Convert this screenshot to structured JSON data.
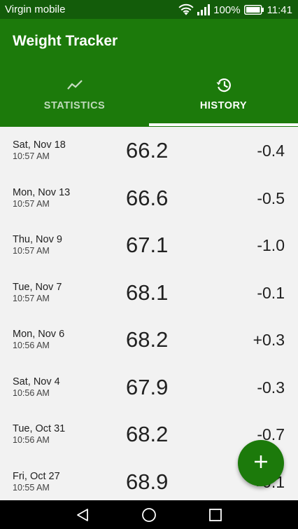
{
  "status_bar": {
    "carrier": "Virgin mobile",
    "battery": "100%",
    "time": "11:41",
    "icons": [
      "wifi-icon",
      "signal-icon",
      "battery-icon"
    ]
  },
  "app": {
    "title": "Weight Tracker"
  },
  "tabs": [
    {
      "label": "STATISTICS",
      "icon": "trending-up-icon",
      "selected": false
    },
    {
      "label": "HISTORY",
      "icon": "history-icon",
      "selected": true
    }
  ],
  "entries": [
    {
      "date": "Sat, Nov 18",
      "time": "10:57 AM",
      "weight": "66.2",
      "change": "-0.4"
    },
    {
      "date": "Mon, Nov 13",
      "time": "10:57 AM",
      "weight": "66.6",
      "change": "-0.5"
    },
    {
      "date": "Thu, Nov 9",
      "time": "10:57 AM",
      "weight": "67.1",
      "change": "-1.0"
    },
    {
      "date": "Tue, Nov 7",
      "time": "10:57 AM",
      "weight": "68.1",
      "change": "-0.1"
    },
    {
      "date": "Mon, Nov 6",
      "time": "10:56 AM",
      "weight": "68.2",
      "change": "+0.3"
    },
    {
      "date": "Sat, Nov 4",
      "time": "10:56 AM",
      "weight": "67.9",
      "change": "-0.3"
    },
    {
      "date": "Tue, Oct 31",
      "time": "10:56 AM",
      "weight": "68.2",
      "change": "-0.7"
    },
    {
      "date": "Fri, Oct 27",
      "time": "10:55 AM",
      "weight": "68.9",
      "change": "+0.1"
    }
  ],
  "fab": {
    "icon": "add-icon"
  },
  "colors": {
    "status_bar": "#135c0a",
    "app_bar": "#1c7a0b",
    "background": "#f2f2f2",
    "fab": "#1c7a0b"
  }
}
